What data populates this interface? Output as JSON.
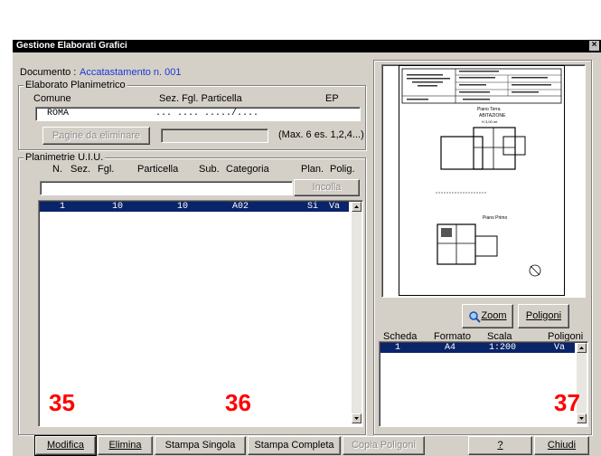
{
  "window": {
    "title": "Gestione Elaborati Grafici",
    "close_glyph": "×"
  },
  "documento": {
    "label": "Documento :",
    "value": "Accatastamento n. 001",
    "value_color": "#1a37d6"
  },
  "elaborato": {
    "group_title": "Elaborato Planimetrico",
    "headers": {
      "comune": "Comune",
      "sez_fgl_part": "Sez. Fgl. Particella",
      "ep": "EP"
    },
    "row": {
      "comune": "ROMA",
      "sez_fgl_part": "... .... ...../...."
    },
    "pagine_button": "Pagine da eliminare",
    "max_hint": "(Max. 6  es. 1,2,4...)"
  },
  "planimetrie": {
    "group_title": "Planimetrie U.I.U.",
    "headers": {
      "n": "N.",
      "sez": "Sez.",
      "fgl": "Fgl.",
      "particella": "Particella",
      "sub": "Sub.",
      "categoria": "Categoria",
      "plan": "Plan.",
      "polig": "Polig."
    },
    "incolla_button": "Incolla",
    "rows": [
      {
        "n": "1",
        "fgl": "10",
        "particella": "10",
        "categoria": "A02",
        "plan": "Si",
        "polig": "Va"
      }
    ]
  },
  "preview": {
    "zoom_button": "Zoom",
    "poligoni_button": "Poligoni",
    "doc_texts": {
      "piano_terra": "Piano Terra",
      "abitazione": "ABITAZIONE",
      "h": "H 3,00 mt",
      "piano_primo": "Piano Primo"
    }
  },
  "schede": {
    "headers": {
      "scheda": "Scheda",
      "formato": "Formato",
      "scala": "Scala",
      "poligoni": "Poligoni"
    },
    "rows": [
      {
        "scheda": "1",
        "formato": "A4",
        "scala": "1:200",
        "poligoni": "Va"
      }
    ]
  },
  "footer_buttons": {
    "modifica": "Modifica",
    "elimina": "Elimina",
    "stampa_singola": "Stampa Singola",
    "stampa_completa": "Stampa Completa",
    "copia_poligoni": "Copia Poligoni",
    "help": "?",
    "chiudi": "Chiudi"
  },
  "annotations": {
    "a": "35",
    "b": "36",
    "c": "37"
  }
}
